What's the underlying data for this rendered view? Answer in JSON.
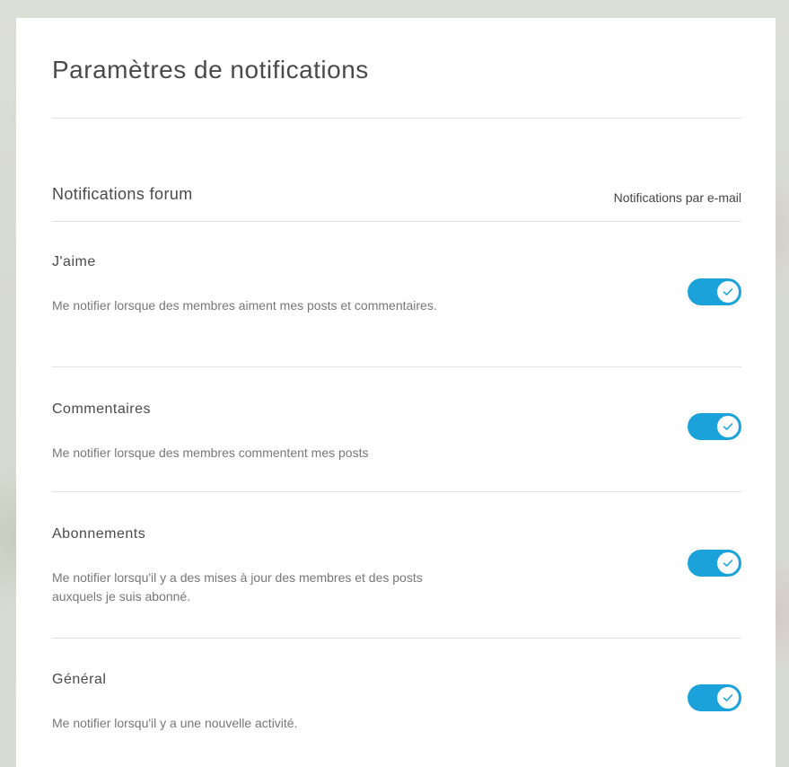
{
  "panel": {
    "title": "Paramètres de notifications",
    "section": {
      "label": "Notifications forum",
      "column_label": "Notifications par e-mail"
    },
    "settings": [
      {
        "title": "J'aime",
        "description": "Me notifier lorsque des membres aiment mes posts et commentaires.",
        "enabled": true
      },
      {
        "title": "Commentaires",
        "description": "Me notifier lorsque des membres commentent mes posts",
        "enabled": true
      },
      {
        "title": "Abonnements",
        "description": "Me notifier lorsqu'il y a des mises à jour des membres et des posts auxquels je suis abonné.",
        "enabled": true
      },
      {
        "title": "Général",
        "description": "Me notifier lorsqu'il y a une nouvelle activité.",
        "enabled": true
      }
    ]
  },
  "colors": {
    "toggle_on": "#1ba2da",
    "panel_background": "#ffffff",
    "divider": "#e3e3e3"
  },
  "icons": {
    "toggle_check": "check-icon"
  }
}
